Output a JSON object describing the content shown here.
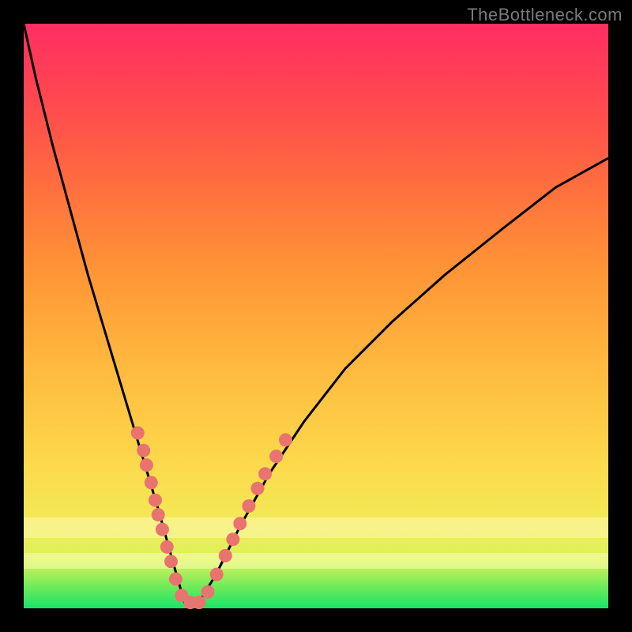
{
  "watermark": "TheBottleneck.com",
  "colors": {
    "frame": "#000000",
    "curve_stroke": "#000000",
    "dot_fill": "#e9746f",
    "gradient_stops": [
      "#19e36a",
      "#5ee95b",
      "#d8f35a",
      "#f2ea57",
      "#fcd94b",
      "#ffb83e",
      "#ff9436",
      "#ff6f3e",
      "#ff4a4e",
      "#ff2e62"
    ]
  },
  "chart_data": {
    "type": "line",
    "title": "",
    "xlabel": "",
    "ylabel": "",
    "xlim": [
      0,
      1
    ],
    "ylim": [
      0,
      1
    ],
    "note": "V-shaped curve; y=1 at x≈0 and y≈0.77 at x=1, minimum y≈0 near x≈0.28. Coordinates normalized to plot area.",
    "series": [
      {
        "name": "curve",
        "x": [
          0.0,
          0.02,
          0.05,
          0.08,
          0.11,
          0.14,
          0.17,
          0.2,
          0.23,
          0.255,
          0.275,
          0.3,
          0.33,
          0.37,
          0.42,
          0.48,
          0.55,
          0.63,
          0.72,
          0.82,
          0.91,
          1.0
        ],
        "values": [
          1.0,
          0.91,
          0.79,
          0.68,
          0.57,
          0.47,
          0.37,
          0.27,
          0.17,
          0.08,
          0.01,
          0.01,
          0.06,
          0.14,
          0.23,
          0.32,
          0.41,
          0.49,
          0.57,
          0.65,
          0.72,
          0.77
        ]
      }
    ],
    "dots": [
      {
        "x": 0.195,
        "y": 0.3
      },
      {
        "x": 0.205,
        "y": 0.27
      },
      {
        "x": 0.21,
        "y": 0.245
      },
      {
        "x": 0.218,
        "y": 0.215
      },
      {
        "x": 0.225,
        "y": 0.185
      },
      {
        "x": 0.23,
        "y": 0.16
      },
      {
        "x": 0.237,
        "y": 0.135
      },
      {
        "x": 0.245,
        "y": 0.105
      },
      {
        "x": 0.252,
        "y": 0.08
      },
      {
        "x": 0.26,
        "y": 0.05
      },
      {
        "x": 0.27,
        "y": 0.022
      },
      {
        "x": 0.285,
        "y": 0.01
      },
      {
        "x": 0.3,
        "y": 0.01
      },
      {
        "x": 0.315,
        "y": 0.028
      },
      {
        "x": 0.33,
        "y": 0.058
      },
      {
        "x": 0.345,
        "y": 0.09
      },
      {
        "x": 0.358,
        "y": 0.118
      },
      {
        "x": 0.37,
        "y": 0.145
      },
      {
        "x": 0.385,
        "y": 0.175
      },
      {
        "x": 0.4,
        "y": 0.205
      },
      {
        "x": 0.413,
        "y": 0.23
      },
      {
        "x": 0.432,
        "y": 0.26
      },
      {
        "x": 0.448,
        "y": 0.288
      }
    ],
    "pale_bands_y": [
      {
        "y0": 0.12,
        "y1": 0.155
      },
      {
        "y0": 0.068,
        "y1": 0.095
      }
    ]
  }
}
